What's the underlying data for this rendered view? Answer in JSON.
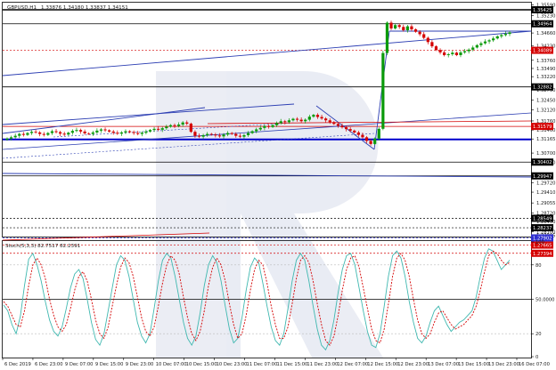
{
  "chart_data": [
    {
      "type": "candlestick",
      "symbol_title": "GBPUSD,H1",
      "ohlc_readout": "1.33876 1.34180 1.33837 1.34151",
      "ylim": [
        1.27945,
        1.3566
      ],
      "y_ticks": [
        "1.35590",
        "1.35230",
        "1.34660",
        "1.34230",
        "1.33760",
        "1.33490",
        "1.33220",
        "1.32790",
        "1.32450",
        "1.32120",
        "1.31760",
        "1.31460",
        "1.31165",
        "1.30700",
        "1.30400",
        "1.29720",
        "1.29410",
        "1.29055",
        "1.28720",
        "1.28450",
        "1.28100",
        "1.27985"
      ],
      "price_labels": [
        {
          "text": "1.35425",
          "color": "#000000"
        },
        {
          "text": "1.34964",
          "color": "#000000"
        },
        {
          "text": "1.34089",
          "color": "#d40000"
        },
        {
          "text": "1.32882",
          "color": "#000000"
        },
        {
          "text": "1.31579",
          "color": "#d40000"
        },
        {
          "text": "1.30402",
          "color": "#000000"
        },
        {
          "text": "1.29947",
          "color": "#000000"
        },
        {
          "text": "1.28549",
          "color": "#000000"
        },
        {
          "text": "1.28237",
          "color": "#000000"
        },
        {
          "text": "1.27902",
          "color": "#3030d0"
        },
        {
          "text": "1.27665",
          "color": "#d40000"
        },
        {
          "text": "1.27394",
          "color": "#d40000"
        }
      ],
      "x_ticks": [
        "6 Dec 2019",
        "6 Dec 23:00",
        "9 Dec 07:00",
        "9 Dec 15:00",
        "9 Dec 23:00",
        "10 Dec 07:00",
        "10 Dec 15:00",
        "10 Dec 23:00",
        "11 Dec 07:00",
        "11 Dec 15:00",
        "11 Dec 23:00",
        "12 Dec 07:00",
        "12 Dec 15:00",
        "12 Dec 23:00",
        "13 Dec 07:00",
        "13 Dec 15:00",
        "13 Dec 23:00",
        "16 Dec 07:00"
      ],
      "series_close": [
        1.3118,
        1.3122,
        1.3127,
        1.3133,
        1.313,
        1.3136,
        1.314,
        1.3138,
        1.3133,
        1.313,
        1.3136,
        1.3142,
        1.3139,
        1.3134,
        1.3131,
        1.3137,
        1.3143,
        1.3146,
        1.3141,
        1.3135,
        1.3133,
        1.3138,
        1.3144,
        1.3148,
        1.3145,
        1.3141,
        1.3137,
        1.3134,
        1.3138,
        1.3142,
        1.3139,
        1.3136,
        1.3133,
        1.3137,
        1.3141,
        1.3146,
        1.315,
        1.3147,
        1.3152,
        1.3157,
        1.3162,
        1.3159,
        1.3164,
        1.3171,
        1.3167,
        1.314,
        1.3127,
        1.3124,
        1.3129,
        1.3133,
        1.3131,
        1.3128,
        1.3125,
        1.3131,
        1.3136,
        1.3133,
        1.3127,
        1.3124,
        1.3129,
        1.3136,
        1.3142,
        1.3148,
        1.3153,
        1.3159,
        1.3156,
        1.3162,
        1.3169,
        1.3175,
        1.3172,
        1.3178,
        1.3183,
        1.318,
        1.3175,
        1.318,
        1.319,
        1.3196,
        1.3189,
        1.3184,
        1.3178,
        1.3172,
        1.3166,
        1.316,
        1.3155,
        1.3149,
        1.3144,
        1.3138,
        1.313,
        1.3122,
        1.311,
        1.31,
        1.3118,
        1.315,
        1.34,
        1.35,
        1.3481,
        1.3492,
        1.3486,
        1.3475,
        1.3488,
        1.3478,
        1.347,
        1.3462,
        1.345,
        1.3436,
        1.3422,
        1.341,
        1.3402,
        1.3393,
        1.3396,
        1.3401,
        1.3393,
        1.3402,
        1.3406,
        1.3411,
        1.3418,
        1.3426,
        1.3432,
        1.3438,
        1.3442,
        1.3448,
        1.3455,
        1.3459,
        1.3463,
        1.3468
      ],
      "stochastic": {
        "title": "Stoch(5,3,3) 82.7517 82.2391",
        "ylim": [
          0,
          100
        ],
        "levels": [
          {
            "text": "100",
            "value": 100
          },
          {
            "text": "80",
            "value": 80
          },
          {
            "text": "50.0000",
            "value": 50
          },
          {
            "text": "20",
            "value": 20
          },
          {
            "text": "0",
            "value": 0
          }
        ],
        "main": [
          45,
          40,
          28,
          20,
          35,
          62,
          85,
          90,
          80,
          66,
          48,
          32,
          22,
          18,
          26,
          42,
          60,
          72,
          76,
          68,
          50,
          30,
          15,
          10,
          20,
          40,
          60,
          80,
          88,
          84,
          70,
          50,
          30,
          18,
          12,
          20,
          42,
          66,
          84,
          90,
          86,
          70,
          50,
          30,
          16,
          10,
          18,
          38,
          62,
          80,
          88,
          82,
          66,
          44,
          24,
          12,
          16,
          34,
          58,
          78,
          86,
          82,
          64,
          44,
          26,
          14,
          10,
          20,
          42,
          66,
          84,
          90,
          84,
          66,
          44,
          24,
          10,
          6,
          14,
          32,
          56,
          76,
          88,
          90,
          80,
          60,
          40,
          22,
          10,
          8,
          20,
          44,
          70,
          88,
          92,
          86,
          70,
          48,
          30,
          16,
          12,
          18,
          30,
          40,
          44,
          36,
          28,
          22,
          26,
          30,
          32,
          36,
          40,
          52,
          70,
          86,
          94,
          92,
          84,
          76,
          80,
          84
        ],
        "signal": [
          48,
          44,
          36,
          28,
          26,
          40,
          62,
          80,
          86,
          80,
          68,
          50,
          36,
          26,
          22,
          28,
          42,
          58,
          70,
          74,
          66,
          50,
          32,
          20,
          16,
          26,
          44,
          62,
          78,
          86,
          82,
          70,
          52,
          34,
          22,
          18,
          26,
          44,
          64,
          80,
          88,
          84,
          72,
          52,
          34,
          20,
          14,
          22,
          40,
          62,
          78,
          86,
          80,
          66,
          46,
          28,
          16,
          20,
          36,
          58,
          76,
          84,
          80,
          64,
          44,
          28,
          16,
          16,
          26,
          46,
          68,
          84,
          88,
          82,
          66,
          46,
          28,
          14,
          10,
          18,
          36,
          58,
          76,
          86,
          88,
          78,
          60,
          42,
          24,
          14,
          12,
          24,
          46,
          70,
          86,
          90,
          84,
          70,
          50,
          32,
          20,
          16,
          20,
          30,
          38,
          40,
          34,
          28,
          24,
          26,
          28,
          32,
          36,
          44,
          58,
          74,
          88,
          92,
          90,
          84,
          80,
          82
        ]
      }
    }
  ]
}
